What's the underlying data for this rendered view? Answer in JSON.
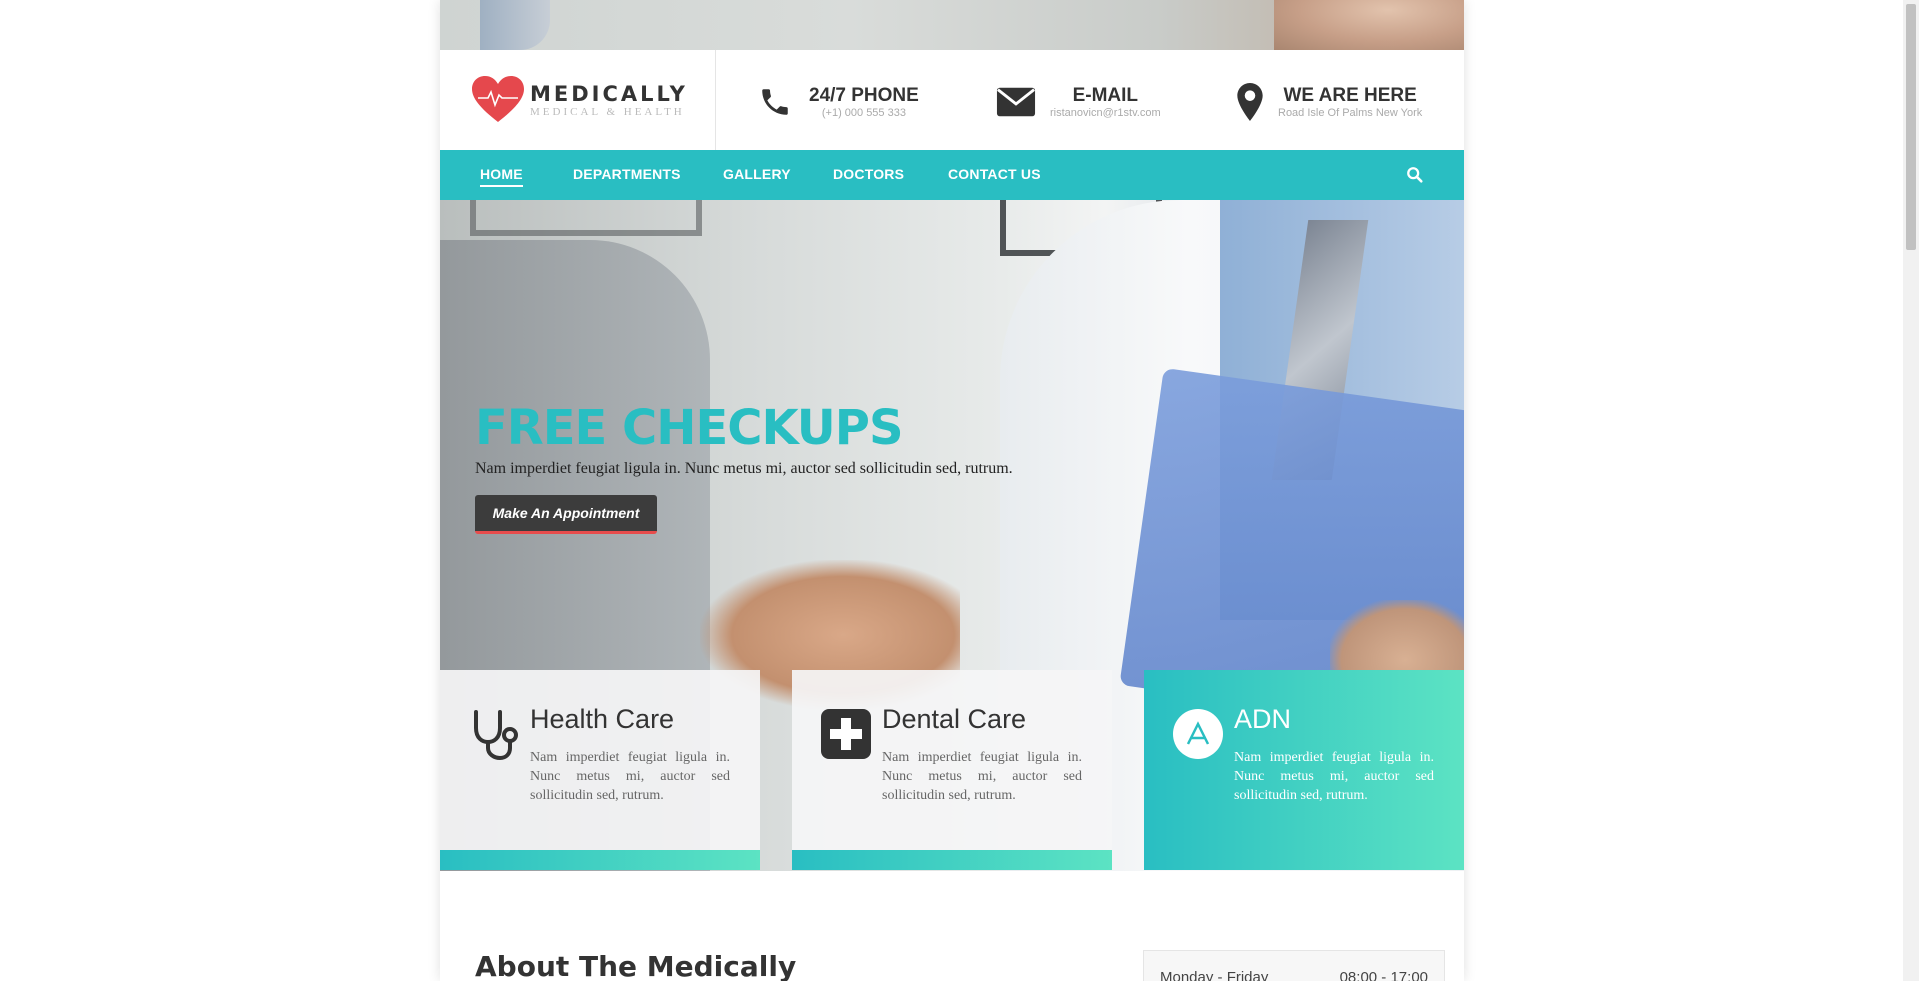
{
  "brand": {
    "name": "MEDICALLY",
    "tagline": "MEDICAL & HEALTH",
    "heart_color": "#e5484d"
  },
  "contacts": [
    {
      "label": "24/7 PHONE",
      "value": "(+1) 000 555 333",
      "icon": "phone-icon"
    },
    {
      "label": "E-MAIL",
      "value": "ristanovicn@r1stv.com",
      "icon": "envelope-icon"
    },
    {
      "label": "WE ARE HERE",
      "value": "Road Isle Of Palms New York",
      "icon": "map-pin-icon"
    }
  ],
  "nav": {
    "items": [
      "HOME",
      "DEPARTMENTS",
      "GALLERY",
      "DOCTORS",
      "CONTACT US"
    ],
    "active": "HOME",
    "search_icon": "search-icon",
    "color": "#29bec2"
  },
  "hero": {
    "title": "FREE CHECKUPS",
    "subtitle": "Nam imperdiet feugiat ligula in. Nunc metus mi, auctor sed sollicitudin sed, rutrum.",
    "button": "Make An Appointment"
  },
  "cards": [
    {
      "title": "Health Care",
      "text": "Nam imperdiet feugiat ligula in. Nunc metus mi, auctor sed sollicitudin sed, rutrum.",
      "icon": "stethoscope-icon"
    },
    {
      "title": "Dental Care",
      "text": "Nam imperdiet feugiat ligula in. Nunc metus mi, auctor sed sollicitudin sed, rutrum.",
      "icon": "medical-cross-icon"
    },
    {
      "title": "ADN",
      "text": "Nam imperdiet feugiat ligula in. Nunc metus mi, auctor sed sollicitudin sed, rutrum.",
      "icon": "adn-icon"
    }
  ],
  "about": {
    "title": "About The Medically"
  },
  "hours": {
    "days": "Monday - Friday",
    "time": "08:00 - 17:00"
  },
  "accent_gradient": [
    "#29bec2",
    "#5ce3c3"
  ],
  "button_accent": "#e74c4c"
}
